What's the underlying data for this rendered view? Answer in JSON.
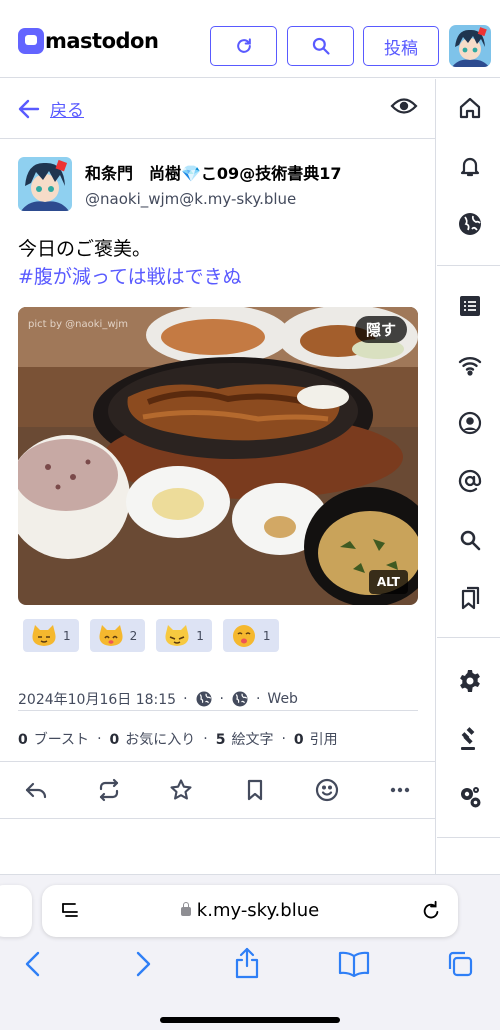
{
  "header": {
    "logo_text": "mastodon",
    "post_label": "投稿",
    "icons": [
      "refresh-icon",
      "search-icon"
    ]
  },
  "nav": {
    "back_label": "戻る"
  },
  "status": {
    "display_name": "和条門　尚樹💎こ09@技術書典17",
    "acct": "@naoki_wjm@k.my-sky.blue",
    "text_line1": "今日のご褒美。",
    "hashtag": "#腹が減っては戦はできぬ",
    "media_hide_label": "隠す",
    "media_alt_label": "ALT",
    "watermark": "pict by @naoki_wjm",
    "reactions": [
      {
        "emoji": "cat-emoji",
        "count": "1"
      },
      {
        "emoji": "cat-emoji",
        "count": "2"
      },
      {
        "emoji": "cat-emoji",
        "count": "1"
      },
      {
        "emoji": "face-emoji",
        "count": "1"
      }
    ],
    "timestamp": "2024年10月16日 18:15",
    "visibility_icon": "globe-icon",
    "language_icon": "globe-icon",
    "via": "Web",
    "counts": {
      "boosts": "0",
      "boosts_label": "ブースト",
      "favs": "0",
      "favs_label": "お気に入り",
      "emoji": "5",
      "emoji_label": "絵文字",
      "quotes": "0",
      "quotes_label": "引用"
    }
  },
  "browser": {
    "url": "k.my-sky.blue"
  },
  "colors": {
    "accent": "#595aff",
    "brand": "#6364ff",
    "border": "#dadde4",
    "ios_blue": "#2f7ff6"
  }
}
